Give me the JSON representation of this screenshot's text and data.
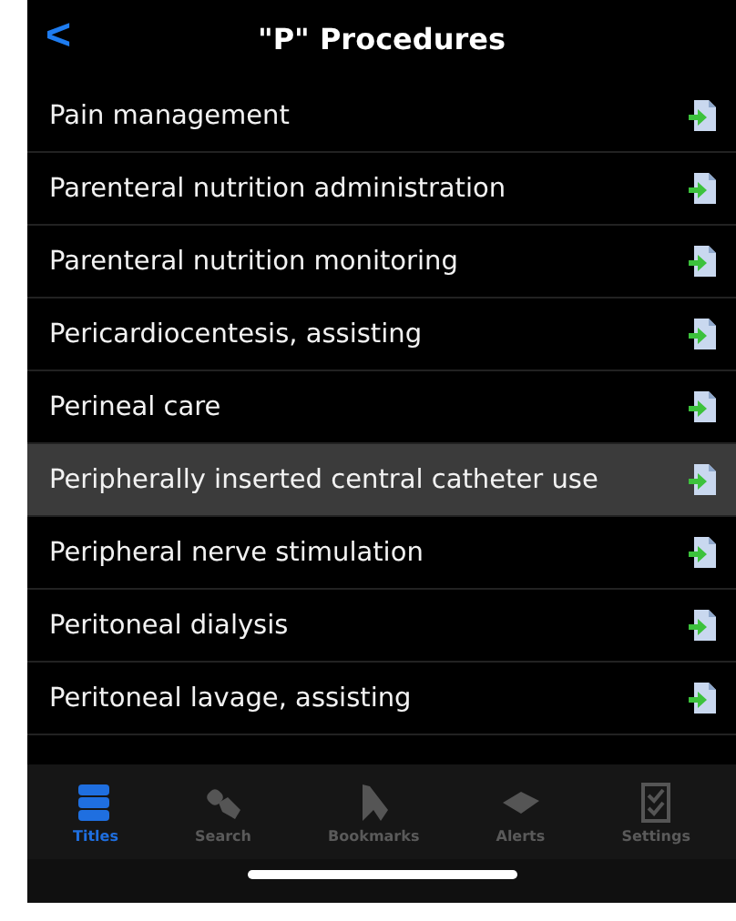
{
  "header": {
    "back": "<",
    "title": "\"P\" Procedures"
  },
  "items": [
    {
      "label": "Pain management",
      "selected": false
    },
    {
      "label": "Parenteral nutrition administration",
      "selected": false
    },
    {
      "label": "Parenteral nutrition monitoring",
      "selected": false
    },
    {
      "label": "Pericardiocentesis, assisting",
      "selected": false
    },
    {
      "label": "Perineal care",
      "selected": false
    },
    {
      "label": "Peripherally inserted central catheter use",
      "selected": true
    },
    {
      "label": "Peripheral nerve stimulation",
      "selected": false
    },
    {
      "label": "Peritoneal dialysis",
      "selected": false
    },
    {
      "label": "Peritoneal lavage, assisting",
      "selected": false
    }
  ],
  "tabs": [
    {
      "label": "Titles",
      "kind": "titles",
      "selected": true
    },
    {
      "label": "Search",
      "kind": "search",
      "selected": false
    },
    {
      "label": "Bookmarks",
      "kind": "bookmarks",
      "selected": false
    },
    {
      "label": "Alerts",
      "kind": "alerts",
      "selected": false
    },
    {
      "label": "Settings",
      "kind": "settings",
      "selected": false
    }
  ]
}
